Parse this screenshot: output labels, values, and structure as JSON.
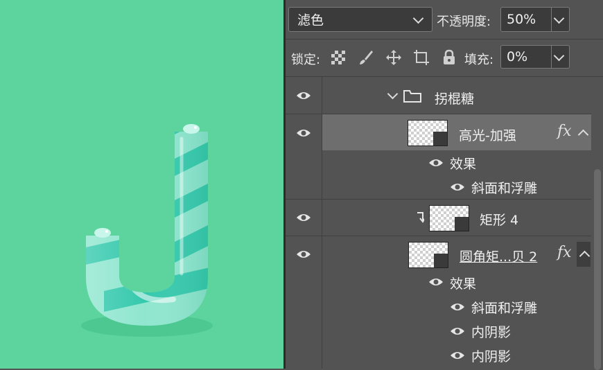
{
  "options_bar": {
    "blend_mode": "滤色",
    "opacity_label": "不透明度:",
    "opacity_value": "50%",
    "lock_label": "锁定:",
    "fill_label": "填充:",
    "fill_value": "0%"
  },
  "lock_icons": [
    "lock-transparent-pixels-icon",
    "lock-image-pixels-icon",
    "lock-position-icon",
    "lock-artboard-icon",
    "lock-all-icon"
  ],
  "layers": {
    "group_name": "拐棍糖",
    "layer1": {
      "name": "高光-加强",
      "fx": "fx",
      "effects_label": "效果",
      "effects": [
        "斜面和浮雕"
      ]
    },
    "layer2": {
      "name": "矩形 4"
    },
    "layer3": {
      "name": "圆角矩...贝 2",
      "fx": "fx",
      "effects_label": "效果",
      "effects": [
        "斜面和浮雕",
        "内阴影",
        "内阴影"
      ]
    }
  },
  "colors": {
    "canvas_bg": "#5dd39e",
    "panel_bg": "#535353",
    "selected_row": "#6e6e6e"
  }
}
